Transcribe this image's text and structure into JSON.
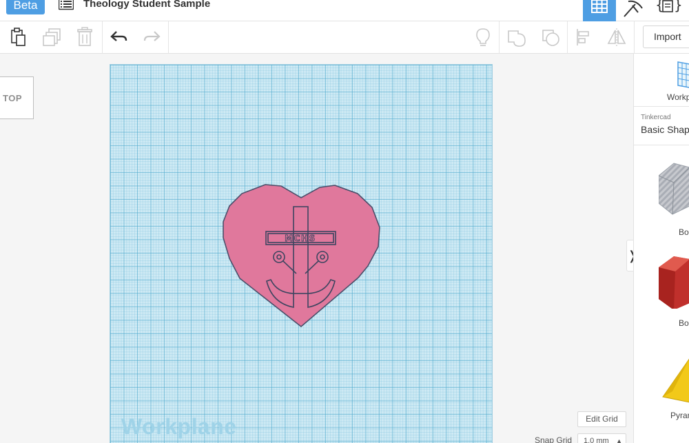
{
  "header": {
    "badge": "Beta",
    "title": "Theology Student Sample"
  },
  "toolbar": {
    "import_label": "Import"
  },
  "viewcube": {
    "face_label": "TOP"
  },
  "workplane": {
    "label": "Workplane",
    "design_text": "MCHS",
    "design_color": "#e0789c"
  },
  "grid_controls": {
    "edit_grid_label": "Edit Grid",
    "snap_grid_label": "Snap Grid",
    "snap_grid_value": "1.0 mm"
  },
  "shapes_panel": {
    "workplane_tool_label": "Workp",
    "library_source": "Tinkercad",
    "library_name": "Basic Shap",
    "collapse_glyph": "❭",
    "items": [
      {
        "label": "Bo",
        "icon": "box-hole-icon",
        "color": "#b9bcc3"
      },
      {
        "label": "Bo",
        "icon": "box-icon",
        "color": "#c0302c"
      },
      {
        "label": "Pyran",
        "icon": "pyramid-icon",
        "color": "#f2c919"
      }
    ]
  },
  "colors": {
    "accent": "#4e9ee3",
    "workplane_bg": "#cfeaf4"
  }
}
